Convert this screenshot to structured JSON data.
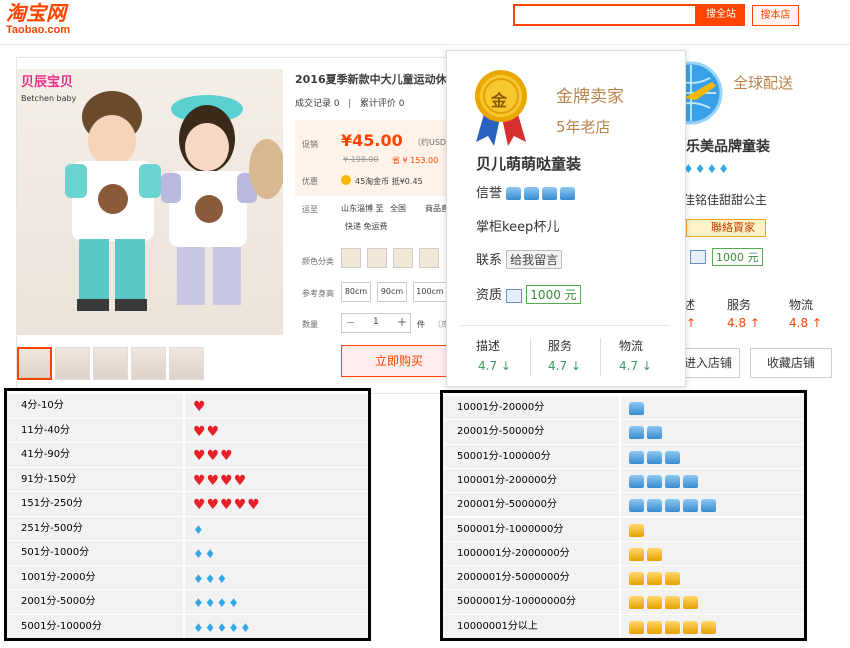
{
  "header": {
    "logo_cn": "淘宝网",
    "logo_en": "Taobao.com",
    "search_placeholder": "",
    "search_all_label": "搜全站",
    "search_shop_label": "搜本店"
  },
  "product": {
    "brand_logo": "贝辰宝贝",
    "brand_logo_en": "Betchen baby",
    "title": "2016夏季新款中大儿童运动休闲",
    "sales_label": "成交记录",
    "sales_count": "0",
    "reviews_label": "累计评价",
    "reviews_count": "0",
    "promo_label": "促销",
    "price": "¥45.00",
    "price_usd": "（约USD (",
    "old_price": "¥ 198.00",
    "save": "省 ¥ 153.00",
    "discount_label": "优惠",
    "coin_text": "45淘金币 抵¥0.45",
    "ship_label": "运至",
    "ship_from": "山东淄博 至",
    "ship_to": "全国",
    "ship_extra": "商品直",
    "ship_fast": "快递 免运费",
    "color_label": "颜色分类",
    "size_label": "参考身高",
    "sizes": [
      "80cm",
      "90cm",
      "100cm"
    ],
    "qty_label": "数量",
    "qty_minus": "−",
    "qty_value": "1",
    "qty_plus": "+",
    "qty_unit": "件",
    "stock": "（库",
    "buy_label": "立即购买"
  },
  "popup": {
    "medal_char": "金",
    "gold_seller": "金牌卖家",
    "years": "5年老店",
    "shop_name": "贝儿萌萌哒童装",
    "credit_label": "信誉",
    "keeper": "掌柜keep杯儿",
    "contact_label": "联系",
    "contact_btn": "给我留言",
    "qual_label": "资质",
    "qual_badge": "1000 元",
    "score_headers": [
      "描述",
      "服务",
      "物流"
    ],
    "scores": [
      "4.7 ↓",
      "4.7 ↓",
      "4.7 ↓"
    ]
  },
  "seller_panel": {
    "global_shipping": "全球配送",
    "shop_name": "乐美品牌童装",
    "keeper": "佳铭佳甜甜公主",
    "tag": "聯絡賣家",
    "badge": "1000 元",
    "score_headers": [
      "述",
      "服务",
      "物流"
    ],
    "scores": [
      "↑",
      "4.8 ↑",
      "4.8 ↑"
    ],
    "enter_shop": "进入店铺",
    "fav_shop": "收藏店铺"
  },
  "credit_table_left": [
    {
      "range": "4分-10分",
      "icon": "heart",
      "count": 1
    },
    {
      "range": "11分-40分",
      "icon": "heart",
      "count": 2
    },
    {
      "range": "41分-90分",
      "icon": "heart",
      "count": 3
    },
    {
      "range": "91分-150分",
      "icon": "heart",
      "count": 4
    },
    {
      "range": "151分-250分",
      "icon": "heart",
      "count": 5
    },
    {
      "range": "251分-500分",
      "icon": "diamond",
      "count": 1
    },
    {
      "range": "501分-1000分",
      "icon": "diamond",
      "count": 2
    },
    {
      "range": "1001分-2000分",
      "icon": "diamond",
      "count": 3
    },
    {
      "range": "2001分-5000分",
      "icon": "diamond",
      "count": 4
    },
    {
      "range": "5001分-10000分",
      "icon": "diamond",
      "count": 5
    }
  ],
  "credit_table_right": [
    {
      "range": "10001分-20000分",
      "icon": "blue-crown",
      "count": 1
    },
    {
      "range": "20001分-50000分",
      "icon": "blue-crown",
      "count": 2
    },
    {
      "range": "50001分-100000分",
      "icon": "blue-crown",
      "count": 3
    },
    {
      "range": "100001分-200000分",
      "icon": "blue-crown",
      "count": 4
    },
    {
      "range": "200001分-500000分",
      "icon": "blue-crown",
      "count": 5
    },
    {
      "range": "500001分-1000000分",
      "icon": "gold-crown",
      "count": 1
    },
    {
      "range": "1000001分-2000000分",
      "icon": "gold-crown",
      "count": 2
    },
    {
      "range": "2000001分-5000000分",
      "icon": "gold-crown",
      "count": 3
    },
    {
      "range": "5000001分-10000000分",
      "icon": "gold-crown",
      "count": 4
    },
    {
      "range": "10000001分以上",
      "icon": "gold-crown",
      "count": 5
    }
  ]
}
